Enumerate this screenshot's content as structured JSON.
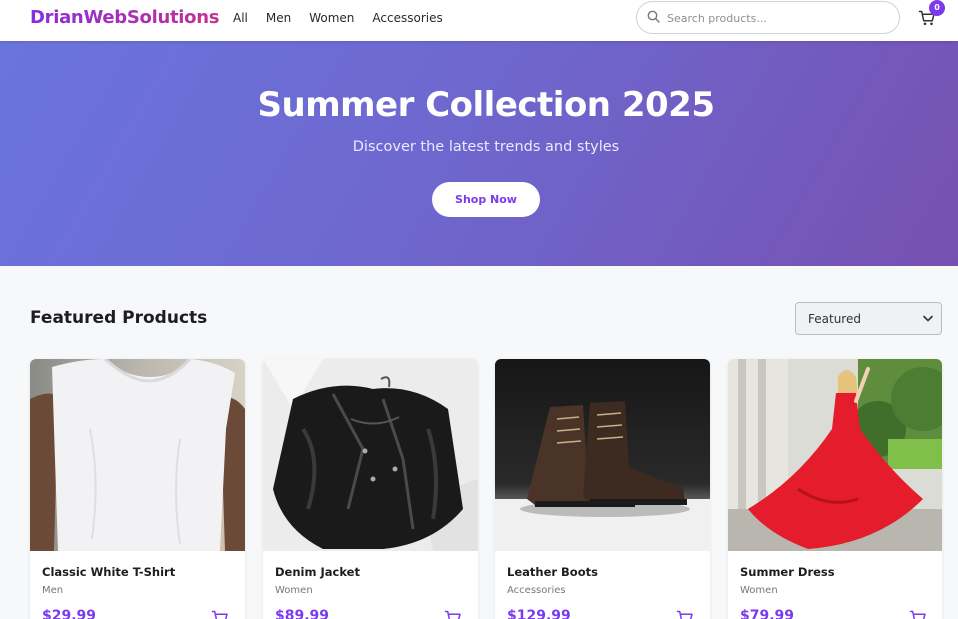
{
  "header": {
    "logo": "DrianWebSolutions",
    "nav": [
      "All",
      "Men",
      "Women",
      "Accessories"
    ],
    "search_placeholder": "Search products...",
    "cart_count": "0"
  },
  "hero": {
    "title": "Summer Collection 2025",
    "subtitle": "Discover the latest trends and styles",
    "button": "Shop Now"
  },
  "featured": {
    "title": "Featured Products",
    "sort_selected": "Featured",
    "products": [
      {
        "name": "Classic White T-Shirt",
        "category": "Men",
        "price": "$29.99"
      },
      {
        "name": "Denim Jacket",
        "category": "Women",
        "price": "$89.99"
      },
      {
        "name": "Leather Boots",
        "category": "Accessories",
        "price": "$129.99"
      },
      {
        "name": "Summer Dress",
        "category": "Women",
        "price": "$79.99"
      }
    ]
  },
  "colors": {
    "accent": "#7c3aed",
    "hero_start": "#6a74dd",
    "hero_end": "#7651b1"
  }
}
